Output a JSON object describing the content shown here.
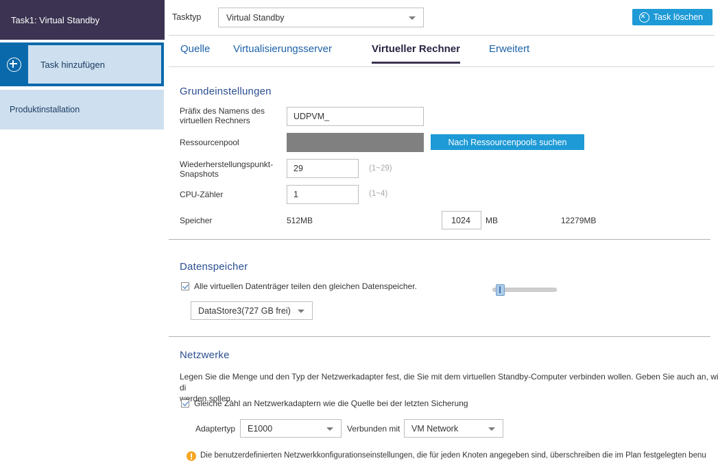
{
  "sidebar": {
    "task_header": "Task1: Virtual Standby",
    "add_task_label": "Task hinzufügen",
    "add_task_icon": "plus-circle-icon",
    "product_install_label": "Produktinstallation"
  },
  "topbar": {
    "tasktype_label": "Tasktyp",
    "tasktype_value": "Virtual Standby",
    "delete_task_label": "Task löschen",
    "delete_task_icon": "close-circle-icon",
    "caret_icon": "chevron-down-icon"
  },
  "tabs": [
    {
      "label": "Quelle",
      "active": false
    },
    {
      "label": "Virtualisierungsserver",
      "active": false
    },
    {
      "label": "Virtueller Rechner",
      "active": true
    },
    {
      "label": "Erweitert",
      "active": false
    }
  ],
  "basic_settings": {
    "title": "Grundeinstellungen",
    "name_prefix": {
      "label": "Präfix des Namens des virtuellen Rechners",
      "value": "UDPVM_"
    },
    "resource_pool": {
      "label": "Ressourcenpool",
      "value": "",
      "button_label": "Nach Ressourcenpools suchen"
    },
    "recovery_snapshots": {
      "label": "Wiederherstellungspunkt-Snapshots",
      "value": "29",
      "hint": "(1~29)"
    },
    "cpu_count": {
      "label": "CPU-Zähler",
      "value": "1",
      "hint": "(1~4)"
    },
    "memory": {
      "label": "Speicher",
      "min_label": "512MB",
      "max_label": "12279MB",
      "value": "1024",
      "unit": "MB"
    }
  },
  "datastore": {
    "title": "Datenspeicher",
    "share_checkbox_label": "Alle virtuellen Datenträger teilen den gleichen Datenspeicher.",
    "share_checked": true,
    "selected_datastore": "DataStore3(727 GB frei)"
  },
  "networks": {
    "title": "Netzwerke",
    "description": "Legen Sie die Menge und den Typ der Netzwerkadapter fest, die Sie mit dem virtuellen Standby-Computer verbinden wollen. Geben Sie auch an, wie di\nwerden sollen.",
    "same_count_checkbox_label": "Gleiche Zahl an Netzwerkadaptern wie die Quelle bei der letzten Sicherung",
    "same_count_checked": true,
    "adapter_type_label": "Adaptertyp",
    "adapter_type_value": "E1000",
    "connected_to_label": "Verbunden mit",
    "connected_to_value": "VM Network",
    "warning_icon": "warning-icon",
    "warning_text": "Die benutzerdefinierten Netzwerkkonfigurationseinstellungen, die für jeden Knoten angegeben sind, überschreiben die im Plan festgelegten benu"
  }
}
